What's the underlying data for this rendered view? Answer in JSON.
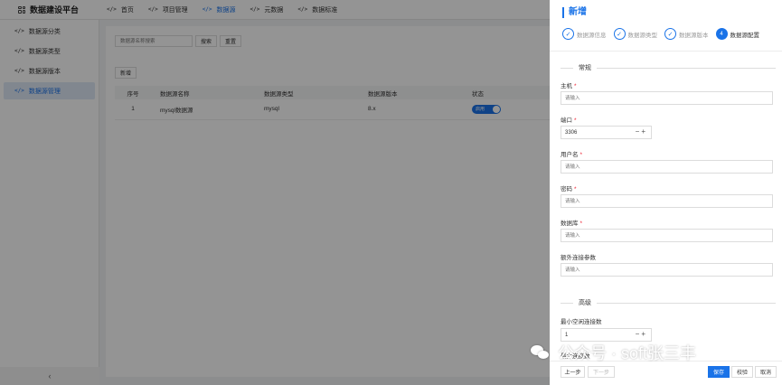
{
  "app": {
    "title": "数据建设平台"
  },
  "topnav": [
    {
      "label": "首页",
      "active": false
    },
    {
      "label": "项目管理",
      "active": false
    },
    {
      "label": "数据源",
      "active": true
    },
    {
      "label": "元数据",
      "active": false
    },
    {
      "label": "数据标准",
      "active": false
    }
  ],
  "sidebar": {
    "items": [
      {
        "label": "数据源分类",
        "active": false
      },
      {
        "label": "数据源类型",
        "active": false
      },
      {
        "label": "数据源版本",
        "active": false
      },
      {
        "label": "数据源管理",
        "active": true
      }
    ],
    "collapse_glyph": "‹"
  },
  "main": {
    "search_placeholder": "数据源名称搜索",
    "search_label": "搜索",
    "reset_label": "重置",
    "add_label": "新增",
    "columns": [
      "序号",
      "数据源名称",
      "数据源类型",
      "数据源版本",
      "状态"
    ],
    "rows": [
      {
        "index": "1",
        "name": "mysql数据源",
        "type": "mysql",
        "version": "8.x",
        "status": "启用",
        "enabled": true
      }
    ]
  },
  "drawer": {
    "title": "新增",
    "steps": [
      {
        "label": "数据源信息",
        "state": "done",
        "glyph": "✓"
      },
      {
        "label": "数据源类型",
        "state": "done",
        "glyph": "✓"
      },
      {
        "label": "数据源版本",
        "state": "done",
        "glyph": "✓"
      },
      {
        "label": "数据源配置",
        "state": "current",
        "glyph": "4"
      }
    ],
    "section_basic": "常规",
    "section_advanced": "高级",
    "fields": {
      "host": {
        "label": "主机",
        "required": "*",
        "placeholder": "请输入"
      },
      "port": {
        "label": "端口",
        "required": "*",
        "value": "3306"
      },
      "username": {
        "label": "用户名",
        "required": "*",
        "placeholder": "请输入"
      },
      "password": {
        "label": "密码",
        "required": "*",
        "placeholder": "请输入"
      },
      "database": {
        "label": "数据库",
        "required": "*",
        "placeholder": "请输入"
      },
      "extra": {
        "label": "额外连接参数",
        "placeholder": "请输入"
      },
      "min_idle": {
        "label": "最小空闲连接数",
        "value": "1"
      },
      "max_conn": {
        "label": "最大连接数"
      }
    },
    "stepper_glyph": "−+",
    "buttons": {
      "prev": "上一步",
      "next": "下一步",
      "save": "保存",
      "verify": "校验",
      "cancel": "取消"
    }
  },
  "watermark": {
    "text": "公众号 · soft张三丰"
  },
  "colors": {
    "accent": "#1a73e8",
    "required": "#e23"
  }
}
